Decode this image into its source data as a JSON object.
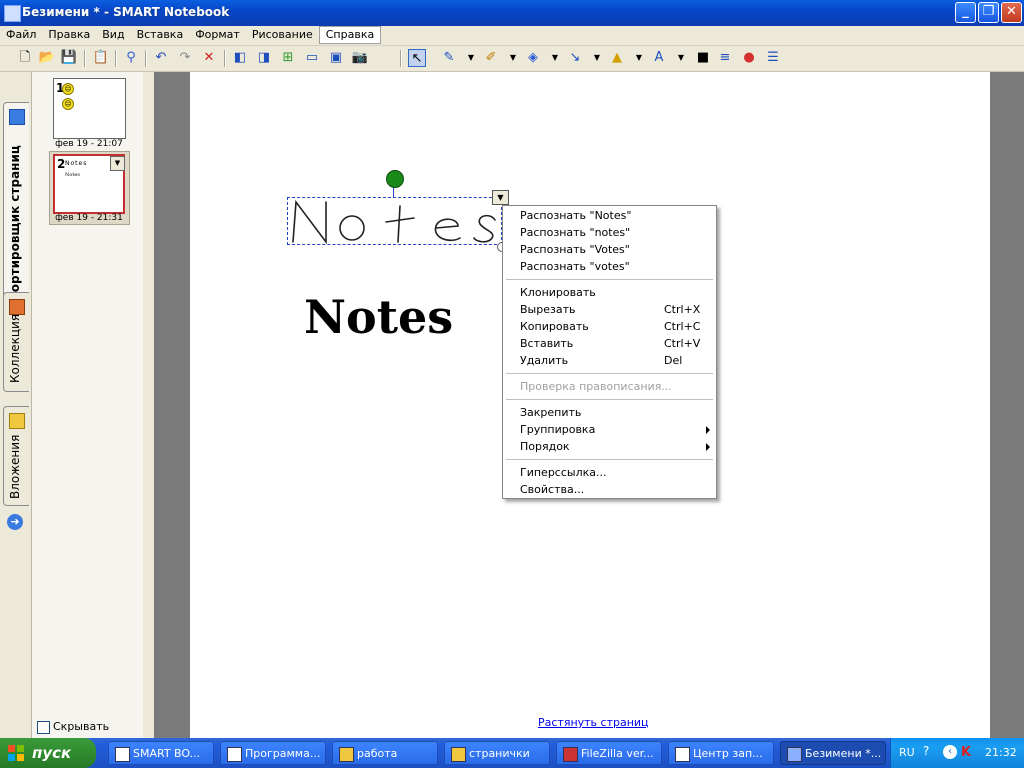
{
  "window": {
    "title": "Безимени * - SMART Notebook"
  },
  "menu": [
    "Файл",
    "Правка",
    "Вид",
    "Вставка",
    "Формат",
    "Рисование",
    "Справка"
  ],
  "left_tabs": {
    "sorter": "Сортировщик страниц",
    "gallery": "Коллекция",
    "attachments": "Вложения"
  },
  "sorter": {
    "pages": [
      {
        "number": "1",
        "date": "фев 19 - 21:07"
      },
      {
        "number": "2",
        "date": "фев 19 - 21:31",
        "thumb_title": "Notes",
        "thumb_text": "Notes"
      }
    ],
    "hide_auto_label": "Скрывать автом"
  },
  "canvas": {
    "handwriting": "Notes",
    "typed_text": "Notes",
    "stretch_link": "Растянуть страниц"
  },
  "context_menu": {
    "recognize": [
      "Распознать \"Notes\"",
      "Распознать \"notes\"",
      "Распознать \"Votes\"",
      "Распознать \"votes\""
    ],
    "clone": "Клонировать",
    "cut": "Вырезать",
    "cut_sc": "Ctrl+X",
    "copy": "Копировать",
    "copy_sc": "Ctrl+C",
    "paste": "Вставить",
    "paste_sc": "Ctrl+V",
    "delete": "Удалить",
    "delete_sc": "Del",
    "spellcheck": "Проверка правописания...",
    "lock": "Закрепить",
    "grouping": "Группировка",
    "order": "Порядок",
    "hyperlink": "Гиперссылка...",
    "properties": "Свойства..."
  },
  "taskbar": {
    "start": "пуск",
    "tasks": [
      "SMART BO...",
      "Программа...",
      "работа",
      "странички",
      "FileZilla ver...",
      "Центр зап...",
      "Безимени *..."
    ],
    "lang": "RU",
    "clock": "21:32"
  },
  "colors": {
    "titlebar": "#0846c8",
    "taskbar": "#245edb",
    "start": "#2e8b2e",
    "handle": "#1a8a1a"
  }
}
